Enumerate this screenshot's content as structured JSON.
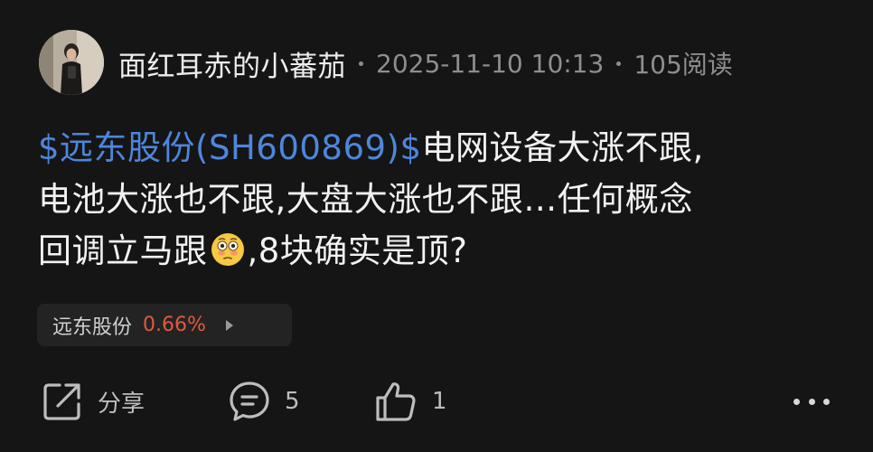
{
  "author": {
    "name": "面红耳赤的小蕃茄",
    "timestamp": "2025-11-10 10:13",
    "reads": "105阅读"
  },
  "post": {
    "stock_tag": "$远东股份(SH600869)$",
    "line1_rest": "电网设备大涨不跟,",
    "line2": "电池大涨也不跟,大盘大涨也不跟…任何概念",
    "line3_before_emoji": "回调立马跟",
    "line3_after_emoji": ",8块确实是顶?",
    "emoji": "flushed-face"
  },
  "stock_chip": {
    "name": "远东股份",
    "change": "0.66%",
    "change_color": "#e05a3c"
  },
  "actions": {
    "share_label": "分享",
    "comment_count": "5",
    "like_count": "1"
  },
  "colors": {
    "background": "#151515",
    "link": "#4d86dc",
    "muted": "#8e8e8e"
  }
}
